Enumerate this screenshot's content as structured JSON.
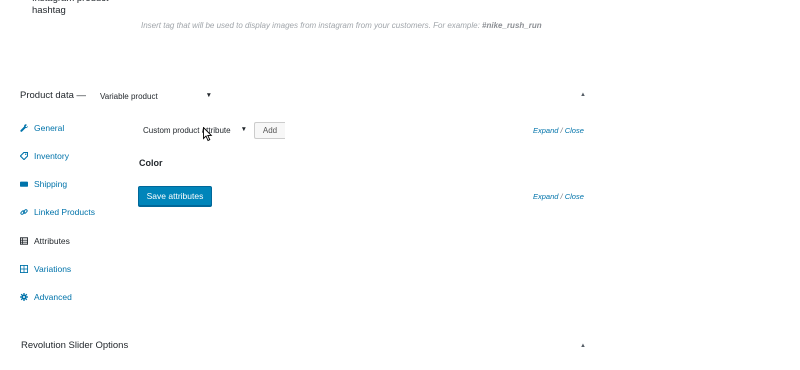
{
  "hashtag_field": {
    "label": "Instagram product hashtag",
    "help_text": "Insert tag that will be used to display images from instagram from your customers. For example: ",
    "help_example": "#nike_rush_run"
  },
  "product_data": {
    "title": "Product data —",
    "product_type": "Variable product",
    "tabs": [
      {
        "label": "General",
        "icon": "wrench-icon"
      },
      {
        "label": "Inventory",
        "icon": "tag-icon"
      },
      {
        "label": "Shipping",
        "icon": "truck-icon"
      },
      {
        "label": "Linked Products",
        "icon": "link-icon"
      },
      {
        "label": "Attributes",
        "icon": "list-icon"
      },
      {
        "label": "Variations",
        "icon": "grid-icon"
      },
      {
        "label": "Advanced",
        "icon": "gear-icon"
      }
    ],
    "active_tab": "Attributes"
  },
  "attributes_panel": {
    "attribute_select": "Custom product attribute",
    "add_label": "Add",
    "expand_label": "Expand",
    "separator": "/",
    "close_label": "Close",
    "attribute_name": "Color",
    "save_label": "Save attributes"
  },
  "revolution": {
    "title": "Revolution Slider Options"
  },
  "colors": {
    "link": "#0073aa",
    "primary_button": "#0085ba",
    "text": "#23282d",
    "muted": "#a0a5aa"
  }
}
